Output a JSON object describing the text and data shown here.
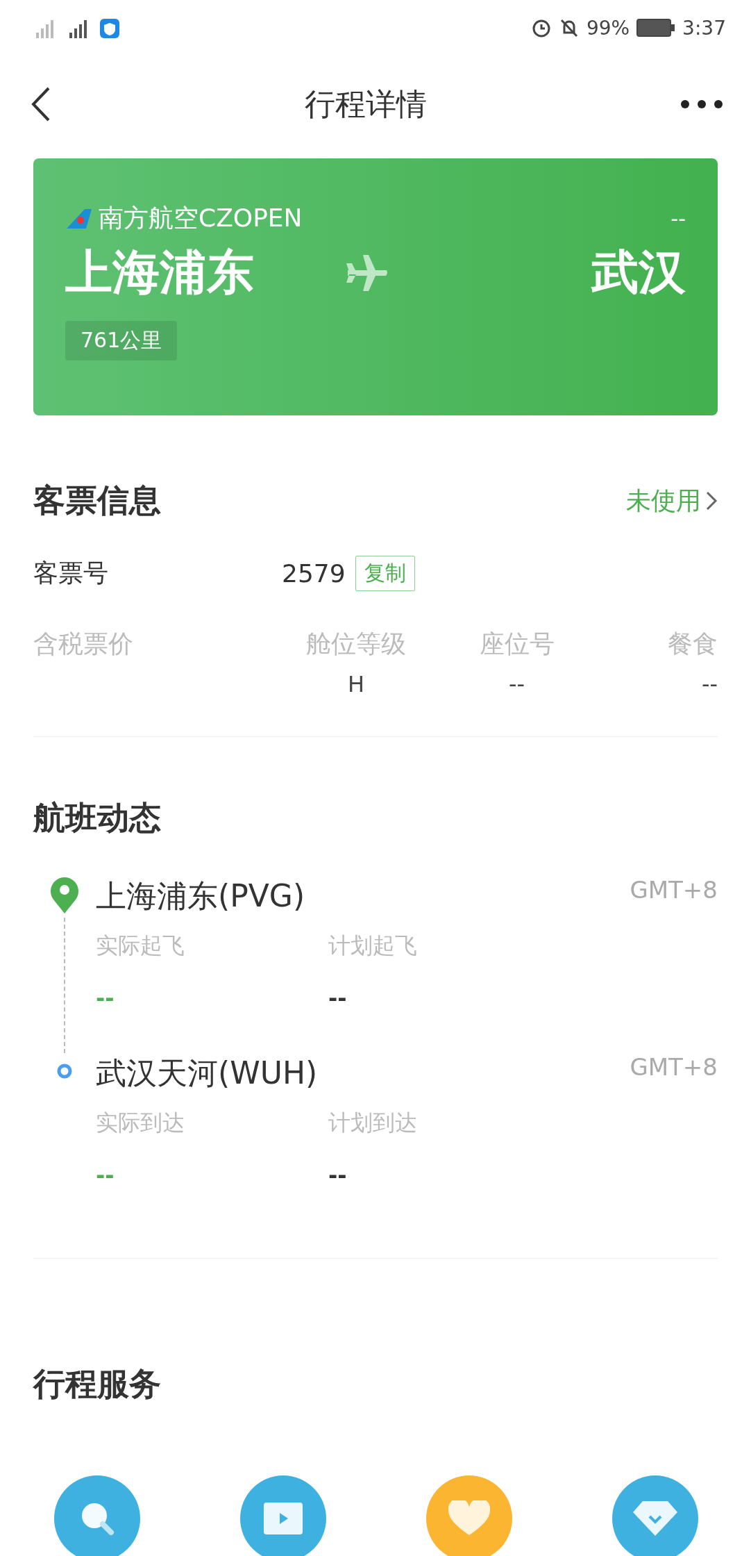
{
  "status_bar": {
    "battery": "99%",
    "time": "3:37"
  },
  "header": {
    "title": "行程详情"
  },
  "flight_card": {
    "airline": "南方航空CZOPEN",
    "flight_status": "--",
    "origin": "上海浦东",
    "destination": "武汉",
    "distance": "761公里"
  },
  "ticket_info": {
    "title": "客票信息",
    "status": "未使用",
    "ticket_label": "客票号",
    "ticket_number": "2579",
    "copy_button": "复制",
    "columns": [
      {
        "label": "含税票价"
      },
      {
        "label": "舱位等级",
        "value": "H"
      },
      {
        "label": "座位号",
        "value": "--"
      },
      {
        "label": "餐食",
        "value": "--"
      }
    ]
  },
  "flight_dynamics": {
    "title": "航班动态",
    "stops": [
      {
        "kind": "departure",
        "airport": "上海浦东(PVG)",
        "timezone": "GMT+8",
        "times": [
          {
            "label": "实际起飞",
            "value": "--",
            "kind": "actual"
          },
          {
            "label": "计划起飞",
            "value": "--",
            "kind": "planned"
          }
        ]
      },
      {
        "kind": "arrival",
        "airport": "武汉天河(WUH)",
        "timezone": "GMT+8",
        "times": [
          {
            "label": "实际到达",
            "value": "--",
            "kind": "actual"
          },
          {
            "label": "计划到达",
            "value": "--",
            "kind": "planned"
          }
        ]
      }
    ]
  },
  "services": {
    "title": "行程服务",
    "items": [
      {
        "kind": "search",
        "color": "#3fb1e0"
      },
      {
        "kind": "video",
        "color": "#3fb1e0"
      },
      {
        "kind": "heart",
        "color": "#fbb531"
      },
      {
        "kind": "diamond",
        "color": "#3fb1e0"
      }
    ]
  }
}
